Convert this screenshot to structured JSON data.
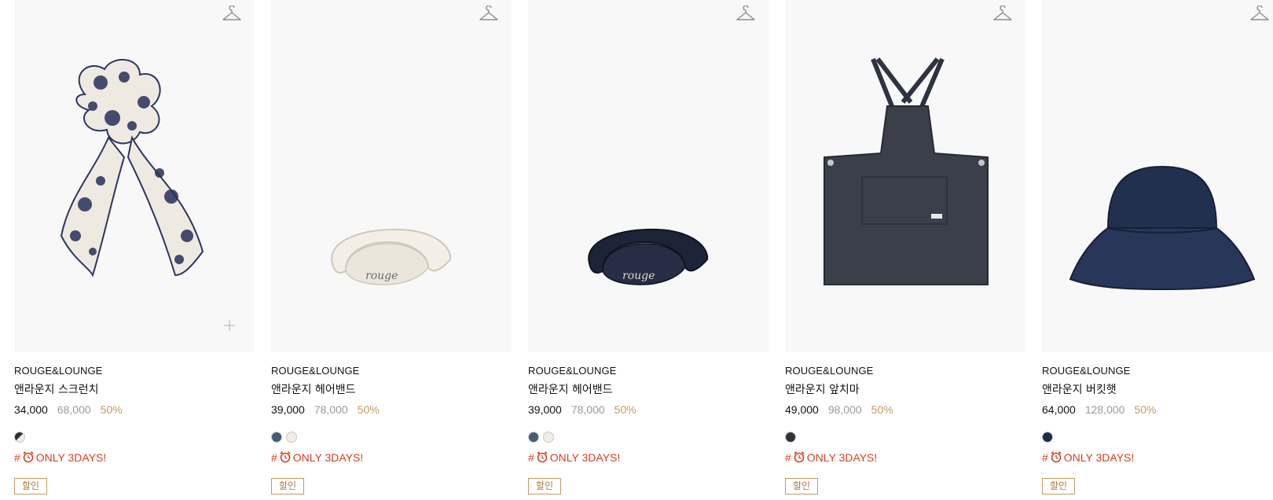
{
  "products": [
    {
      "brand": "ROUGE&LOUNGE",
      "name": "앤라운지 스크런치",
      "price": "34,000",
      "original_price": "68,000",
      "discount": "50%",
      "swatches": [
        "#2b2f3e"
      ],
      "tag_prefix": "#",
      "tag_icon": "alarm-clock-icon",
      "tag_text": "ONLY 3DAYS!",
      "badge": "할인"
    },
    {
      "brand": "ROUGE&LOUNGE",
      "name": "앤라운지 헤어밴드",
      "price": "39,000",
      "original_price": "78,000",
      "discount": "50%",
      "swatches": [
        "#465a7a",
        "#f4ede6"
      ],
      "tag_prefix": "#",
      "tag_icon": "alarm-clock-icon",
      "tag_text": "ONLY 3DAYS!",
      "badge": "할인"
    },
    {
      "brand": "ROUGE&LOUNGE",
      "name": "앤라운지 헤어밴드",
      "price": "39,000",
      "original_price": "78,000",
      "discount": "50%",
      "swatches": [
        "#465a7a",
        "#f4ede6"
      ],
      "tag_prefix": "#",
      "tag_icon": "alarm-clock-icon",
      "tag_text": "ONLY 3DAYS!",
      "badge": "할인"
    },
    {
      "brand": "ROUGE&LOUNGE",
      "name": "앤라운지 앞치마",
      "price": "49,000",
      "original_price": "98,000",
      "discount": "50%",
      "swatches": [
        "#2f3338"
      ],
      "tag_prefix": "#",
      "tag_icon": "alarm-clock-icon",
      "tag_text": "ONLY 3DAYS!",
      "badge": "할인"
    },
    {
      "brand": "ROUGE&LOUNGE",
      "name": "앤라운지 버킷햇",
      "price": "64,000",
      "original_price": "128,000",
      "discount": "50%",
      "swatches": [
        "#1f2c4a"
      ],
      "tag_prefix": "#",
      "tag_icon": "alarm-clock-icon",
      "tag_text": "ONLY 3DAYS!",
      "badge": "할인"
    }
  ],
  "icons": {
    "wishlist": "hanger-icon",
    "quick_add": "plus-icon"
  },
  "colors": {
    "tag_red": "#d7401f",
    "discount_gold": "#c79a62",
    "thumb_bg": "#f8f8f8"
  }
}
